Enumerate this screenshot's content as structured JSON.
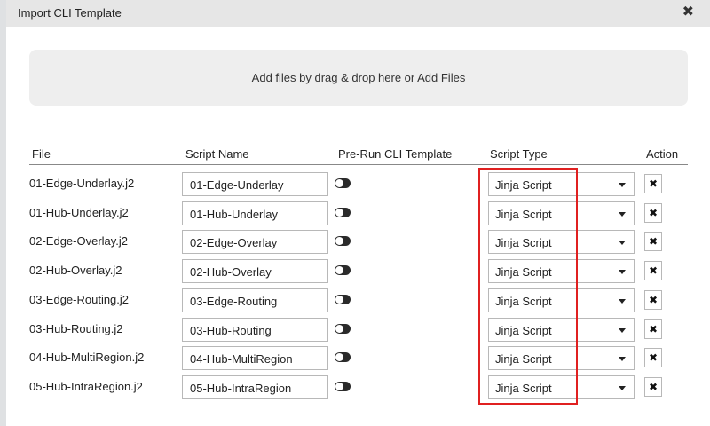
{
  "dialog": {
    "title": "Import CLI Template"
  },
  "dropzone": {
    "text": "Add files by drag & drop here or ",
    "link": "Add Files"
  },
  "table": {
    "headers": {
      "file": "File",
      "script_name": "Script Name",
      "pre_run": "Pre-Run CLI Template",
      "script_type": "Script Type",
      "action": "Action"
    },
    "rows": [
      {
        "file": "01-Edge-Underlay.j2",
        "script_name": "01-Edge-Underlay",
        "script_type": "Jinja Script"
      },
      {
        "file": "01-Hub-Underlay.j2",
        "script_name": "01-Hub-Underlay",
        "script_type": "Jinja Script"
      },
      {
        "file": "02-Edge-Overlay.j2",
        "script_name": "02-Edge-Overlay",
        "script_type": "Jinja Script"
      },
      {
        "file": "02-Hub-Overlay.j2",
        "script_name": "02-Hub-Overlay",
        "script_type": "Jinja Script"
      },
      {
        "file": "03-Edge-Routing.j2",
        "script_name": "03-Edge-Routing",
        "script_type": "Jinja Script"
      },
      {
        "file": "03-Hub-Routing.j2",
        "script_name": "03-Hub-Routing",
        "script_type": "Jinja Script"
      },
      {
        "file": "04-Hub-MultiRegion.j2",
        "script_name": "04-Hub-MultiRegion",
        "script_type": "Jinja Script"
      },
      {
        "file": "05-Hub-IntraRegion.j2",
        "script_name": "05-Hub-IntraRegion",
        "script_type": "Jinja Script"
      }
    ]
  },
  "icons": {
    "close": "close-icon",
    "toggle": "toggle-off-icon",
    "caret": "chevron-down-icon",
    "delete": "x-icon"
  },
  "colors": {
    "highlight": "#e02020",
    "header_bg": "#e6e6e6",
    "dropzone_bg": "#eeeeee"
  }
}
